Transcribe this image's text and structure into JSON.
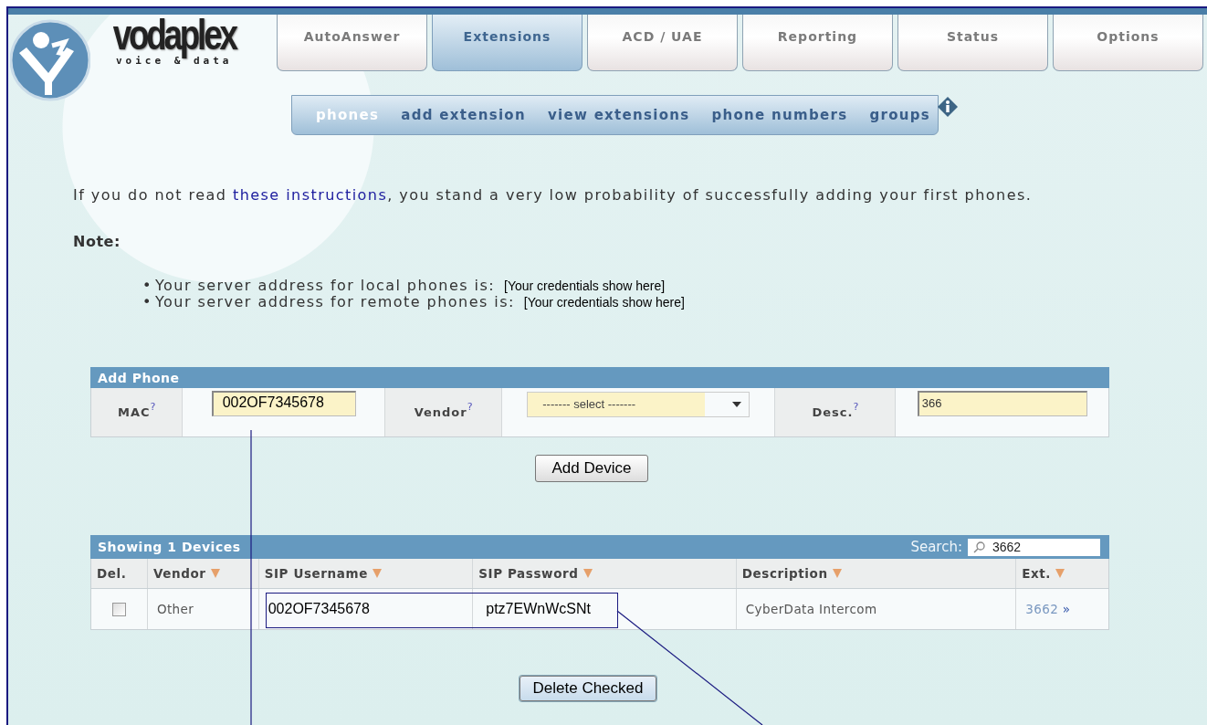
{
  "logo": {
    "name": "vodaplex",
    "tagline": "voice & data"
  },
  "tabs": [
    {
      "label": "AutoAnswer",
      "selected": false
    },
    {
      "label": "Extensions",
      "selected": true
    },
    {
      "label": "ACD / UAE",
      "selected": false
    },
    {
      "label": "Reporting",
      "selected": false
    },
    {
      "label": "Status",
      "selected": false
    },
    {
      "label": "Options",
      "selected": false
    }
  ],
  "subnav": [
    {
      "label": "phones",
      "selected": true
    },
    {
      "label": "add extension",
      "selected": false
    },
    {
      "label": "view extensions",
      "selected": false
    },
    {
      "label": "phone numbers",
      "selected": false
    },
    {
      "label": "groups",
      "selected": false
    }
  ],
  "intro": {
    "text_before": "If you do not read ",
    "link": "these instructions",
    "text_after": ", you stand a very low probability of successfully adding your first phones."
  },
  "note_label": "Note:",
  "server_notes": [
    {
      "bullet": "•",
      "label": "Your server address for local phones is:",
      "value": "[Your credentials show here]"
    },
    {
      "bullet": "•",
      "label": "Your server address for remote phones is:",
      "value": "[Your credentials show here]"
    }
  ],
  "add_phone": {
    "title": "Add Phone",
    "fields": [
      {
        "kind": "text",
        "label": "MAC",
        "help": "?",
        "value": "002OF7345678"
      },
      {
        "kind": "select",
        "label": "Vendor",
        "help": "?",
        "value": "------- select -------"
      },
      {
        "kind": "text",
        "label": "Desc.",
        "help": "?",
        "value": "366"
      }
    ],
    "button": "Add Device"
  },
  "devices": {
    "title": "Showing 1 Devices",
    "search_label": "Search:",
    "search_value": "3662",
    "columns": [
      {
        "label": "Del.",
        "sortable": false
      },
      {
        "label": "Vendor",
        "sortable": true
      },
      {
        "label": "SIP Username",
        "sortable": true
      },
      {
        "label": "SIP Password",
        "sortable": true
      },
      {
        "label": "Description",
        "sortable": true
      },
      {
        "label": "Ext.",
        "sortable": true
      }
    ],
    "rows": [
      {
        "checked": false,
        "vendor": "Other",
        "sip_username": "002OF7345678",
        "sip_password": "ptz7EWnWcSNt",
        "description": "CyberData Intercom",
        "ext": "3662",
        "ext_arrow": "»"
      }
    ],
    "button": "Delete Checked"
  }
}
